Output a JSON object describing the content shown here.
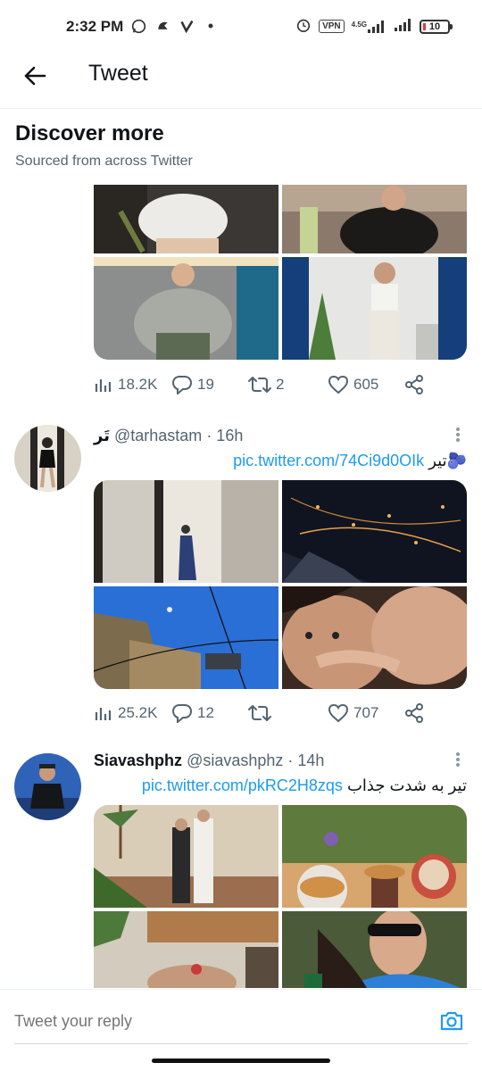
{
  "status_bar": {
    "time": "2:32 PM",
    "vpn": "VPN",
    "network": "4.5G",
    "battery": "10"
  },
  "header": {
    "title": "Tweet"
  },
  "discover": {
    "title": "Discover more",
    "subtitle": "Sourced from across Twitter"
  },
  "tweets": [
    {
      "stats": {
        "views": "18.2K",
        "replies": "19",
        "retweets": "2",
        "likes": "605"
      }
    },
    {
      "author": "تَر",
      "handle": "@tarhastam",
      "time": "· 16h",
      "text": "تیر🫐",
      "link": "pic.twitter.com/74Ci9d0OIk",
      "stats": {
        "views": "25.2K",
        "replies": "12",
        "retweets": "",
        "likes": "707"
      }
    },
    {
      "author": "Siavashphz",
      "handle": "@siavashphz",
      "time": "· 14h",
      "text": "تیر به شدت جذاب",
      "link": "pic.twitter.com/pkRC2H8zqs"
    }
  ],
  "reply": {
    "placeholder": "Tweet your reply"
  },
  "icons": {
    "back": "arrow-left-icon",
    "camera": "camera-icon",
    "views": "bar-chart-icon",
    "reply": "speech-bubble-icon",
    "retweet": "retweet-icon",
    "like": "heart-icon",
    "share": "share-icon"
  },
  "colors": {
    "accent": "#1d9bf0",
    "secondary_text": "#536471"
  }
}
